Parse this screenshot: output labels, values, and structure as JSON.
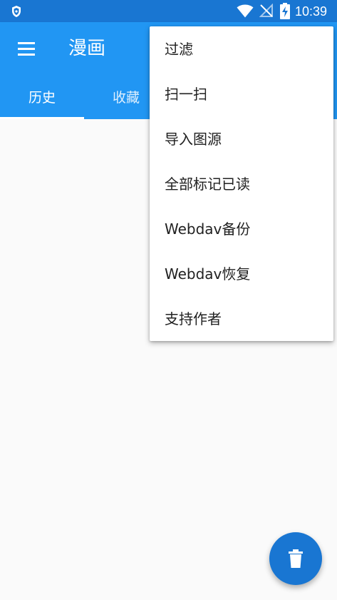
{
  "status_bar": {
    "time": "10:39",
    "icons": [
      "shield-icon",
      "wifi-icon",
      "no-signal-icon",
      "battery-charging-icon"
    ]
  },
  "app_bar": {
    "title": "漫画",
    "menu_icon": "hamburger-menu-icon",
    "tabs": [
      {
        "label": "历史",
        "selected": true
      },
      {
        "label": "收藏",
        "selected": false
      }
    ]
  },
  "overflow_menu": {
    "items": [
      {
        "label": "过滤"
      },
      {
        "label": "扫一扫"
      },
      {
        "label": "导入图源"
      },
      {
        "label": "全部标记已读"
      },
      {
        "label": "Webdav备份"
      },
      {
        "label": "Webdav恢复"
      },
      {
        "label": "支持作者"
      }
    ]
  },
  "fab": {
    "icon": "trash-icon"
  },
  "colors": {
    "status_bar": "#1976d2",
    "app_bar": "#2196f3",
    "fab": "#1976d2",
    "background": "#fafafa"
  }
}
